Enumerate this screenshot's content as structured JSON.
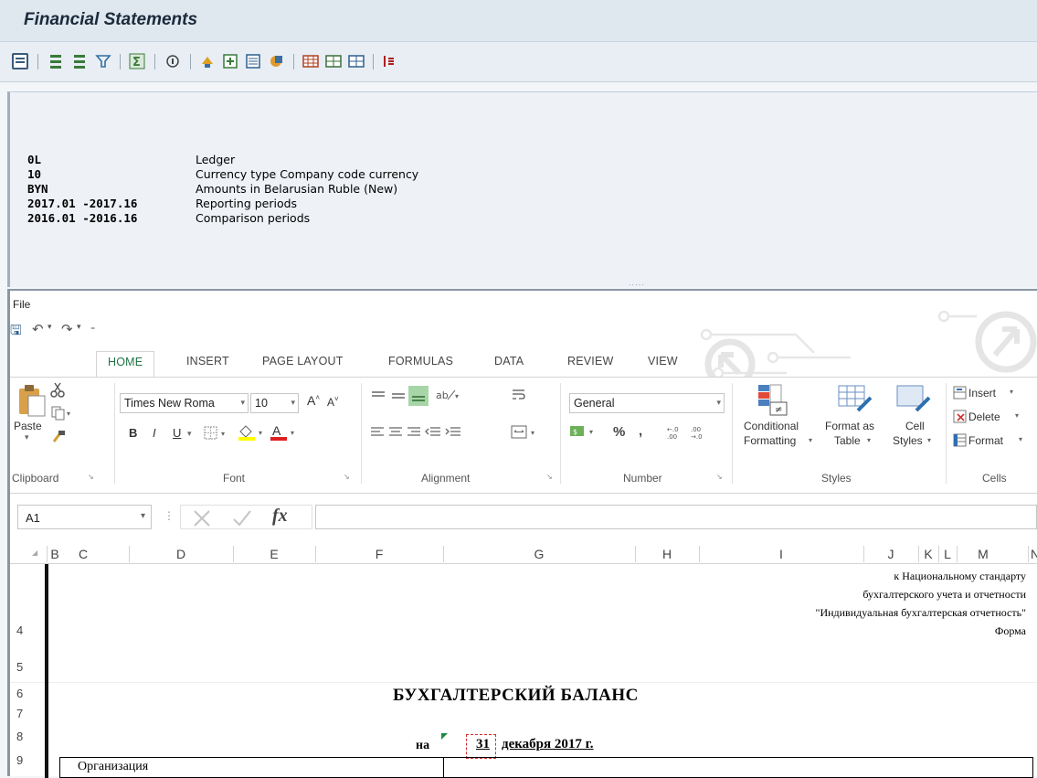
{
  "sap": {
    "title": "Financial Statements",
    "header_rows": [
      {
        "code": "0L",
        "desc": "Ledger"
      },
      {
        "code": "10",
        "desc": "Currency type Company code currency"
      },
      {
        "code": "BYN",
        "desc": "Amounts in Belarusian Ruble (New)"
      },
      {
        "code": "2017.01 -2017.16",
        "desc": "Reporting periods"
      },
      {
        "code": "2016.01 -2016.16",
        "desc": "Comparison periods"
      }
    ],
    "splitter": "....."
  },
  "excel": {
    "file_label": "File",
    "tabs": [
      "HOME",
      "INSERT",
      "PAGE LAYOUT",
      "FORMULAS",
      "DATA",
      "REVIEW",
      "VIEW"
    ],
    "ribbon": {
      "clipboard": {
        "paste": "Paste",
        "label": "Clipboard"
      },
      "font": {
        "name": "Times New Roma",
        "size": "10",
        "bold": "B",
        "italic": "I",
        "underline": "U",
        "label": "Font"
      },
      "alignment": {
        "label": "Alignment"
      },
      "number": {
        "format": "General",
        "percent": "%",
        "comma": ",",
        "label": "Number"
      },
      "styles": {
        "conditional_1": "Conditional",
        "conditional_2": "Formatting",
        "format_table_1": "Format as",
        "format_table_2": "Table",
        "cell_styles_1": "Cell",
        "cell_styles_2": "Styles",
        "label": "Styles"
      },
      "cells": {
        "insert": "Insert",
        "delete": "Delete",
        "format": "Format",
        "label": "Cells"
      }
    },
    "name_box": "A1",
    "fx": "fx",
    "columns": [
      "B",
      "C",
      "D",
      "E",
      "F",
      "G",
      "H",
      "I",
      "J",
      "K",
      "L",
      "M",
      "N"
    ],
    "rows": [
      "4",
      "5",
      "6",
      "7",
      "8",
      "9"
    ],
    "cells": {
      "line1": "к Национальному стандарту",
      "line2": "бухгалтерского учета и отчетности",
      "line3": "\"Индивидуальная бухгалтерская отчетность\"",
      "line4": "Форма",
      "title": "БУХГАЛТЕРСКИЙ БАЛАНС",
      "na": "на",
      "date_day": "31",
      "date_rest": "декабря 2017 г.",
      "org": "Организация"
    }
  },
  "colors": {
    "excel_green": "#217346",
    "sap_bg": "#dfe7ef"
  }
}
